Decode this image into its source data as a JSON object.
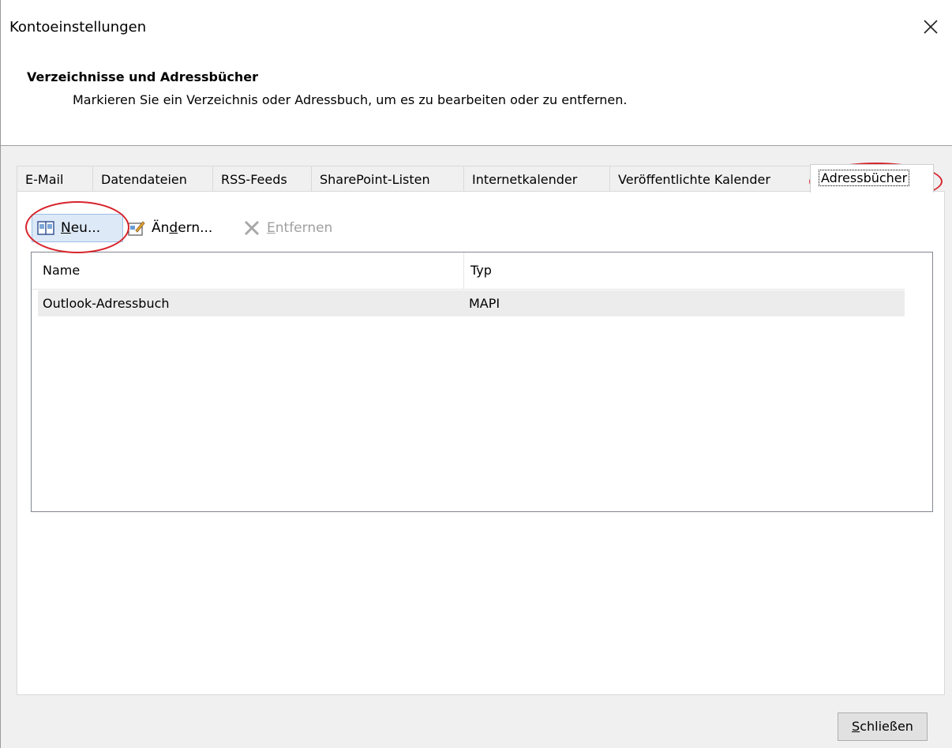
{
  "window": {
    "title": "Kontoeinstellungen"
  },
  "header": {
    "title": "Verzeichnisse und Adressbücher",
    "subtitle": "Markieren Sie ein Verzeichnis oder Adressbuch, um es zu bearbeiten oder zu entfernen."
  },
  "tabs": [
    {
      "label": "E-Mail"
    },
    {
      "label": "Datendateien"
    },
    {
      "label": "RSS-Feeds"
    },
    {
      "label": "SharePoint-Listen"
    },
    {
      "label": "Internetkalender"
    },
    {
      "label": "Veröffentlichte Kalender"
    },
    {
      "label": "Adressbücher",
      "active": true
    }
  ],
  "toolbar": {
    "new_pre": "",
    "new_ul": "N",
    "new_post": "eu...",
    "edit_pre": "Än",
    "edit_ul": "d",
    "edit_post": "ern...",
    "remove_pre": "",
    "remove_ul": "E",
    "remove_post": "ntfernen"
  },
  "list": {
    "columns": {
      "name": "Name",
      "type": "Typ"
    },
    "rows": [
      {
        "name": "Outlook-Adressbuch",
        "type": "MAPI"
      }
    ]
  },
  "footer": {
    "close_ul": "S",
    "close_post": "chließen"
  },
  "colors": {
    "annotation": "#d8242c",
    "selected_button": "#dde9f7"
  },
  "icons": [
    "close-icon",
    "address-book-icon",
    "edit-address-book-icon",
    "remove-icon"
  ]
}
